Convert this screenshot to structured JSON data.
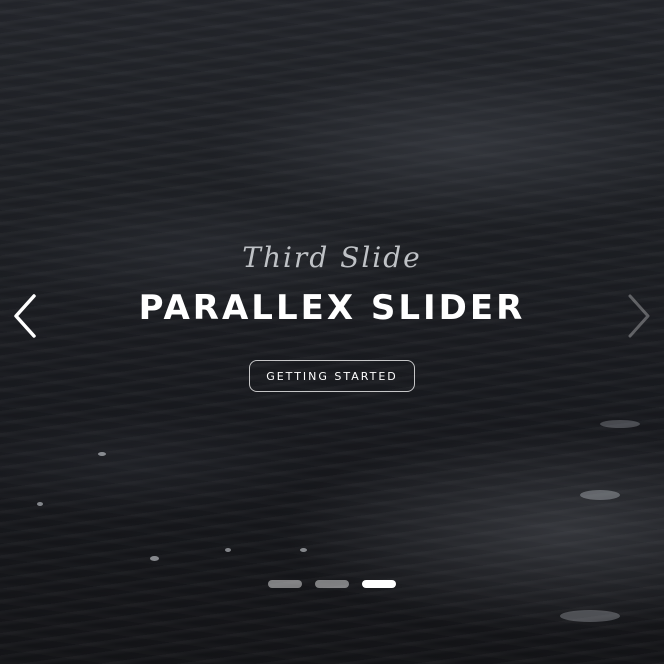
{
  "slide": {
    "subtitle": "Third Slide",
    "title": "PARALLEX SLIDER",
    "button_label": "GETTING STARTED",
    "background": "dark-ocean-waves-photo"
  },
  "navigation": {
    "prev_icon": "chevron-left-icon",
    "next_icon": "chevron-right-icon"
  },
  "indicators": {
    "count": 3,
    "active_index": 2
  },
  "colors": {
    "text": "#ffffff",
    "subtitle": "#bfc2c6",
    "background": "#1e2025"
  }
}
